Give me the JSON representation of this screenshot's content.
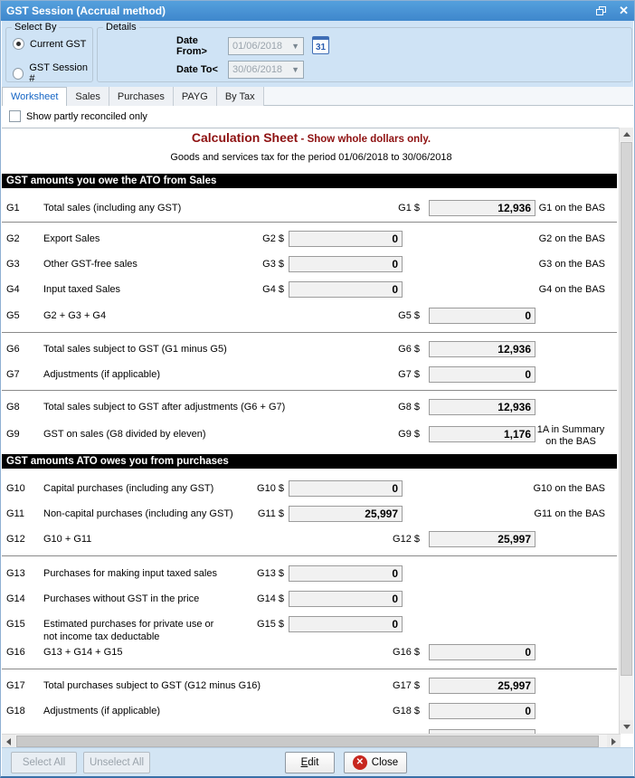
{
  "window": {
    "title": "GST Session (Accrual method)"
  },
  "select_by": {
    "legend": "Select By",
    "options": [
      {
        "label": "Current GST",
        "selected": true
      },
      {
        "label": "GST Session #",
        "selected": false
      }
    ]
  },
  "details": {
    "legend": "Details",
    "date_from_label": "Date From>",
    "date_from_value": "01/06/2018",
    "date_to_label": "Date To<",
    "date_to_value": "30/06/2018",
    "calendar_icon": "31"
  },
  "tabs": [
    {
      "label": "Worksheet",
      "active": true
    },
    {
      "label": "Sales",
      "active": false
    },
    {
      "label": "Purchases",
      "active": false
    },
    {
      "label": "PAYG",
      "active": false
    },
    {
      "label": "By Tax",
      "active": false
    }
  ],
  "filter": {
    "checkbox_label": "Show partly reconciled only",
    "checked": false
  },
  "sheet": {
    "title": "Calculation Sheet",
    "title_separator": " - ",
    "title_suffix": "Show whole dollars only.",
    "period_line": "Goods and services tax for the period 01/06/2018 to 30/06/2018",
    "accent_color": "#8e1111",
    "sections": [
      {
        "title": "GST amounts you owe the ATO from Sales"
      },
      {
        "title": "GST amounts ATO owes you from purchases"
      }
    ],
    "rows": [
      {
        "code": "G1",
        "desc": "Total sales (including any GST)",
        "label": "G1 $",
        "value": "12,936",
        "note": "G1 on the BAS"
      },
      {
        "code": "G2",
        "desc": "Export Sales",
        "label": "G2 $",
        "value": "0",
        "note": "G2 on the BAS"
      },
      {
        "code": "G3",
        "desc": "Other GST-free sales",
        "label": "G3 $",
        "value": "0",
        "note": "G3 on the BAS"
      },
      {
        "code": "G4",
        "desc": "Input taxed Sales",
        "label": "G4 $",
        "value": "0",
        "note": "G4 on the BAS"
      },
      {
        "code": "G5",
        "desc": "G2 + G3 + G4",
        "label": "G5 $",
        "value": "0",
        "note": ""
      },
      {
        "code": "G6",
        "desc": "Total sales subject to GST (G1 minus G5)",
        "label": "G6 $",
        "value": "12,936",
        "note": ""
      },
      {
        "code": "G7",
        "desc": "Adjustments (if applicable)",
        "label": "G7 $",
        "value": "0",
        "note": ""
      },
      {
        "code": "G8",
        "desc": "Total sales subject to GST after adjustments (G6 + G7)",
        "label": "G8 $",
        "value": "12,936",
        "note": ""
      },
      {
        "code": "G9",
        "desc": "GST on sales (G8 divided by eleven)",
        "label": "G9 $",
        "value": "1,176",
        "note": "1A in Summary\non the BAS"
      },
      {
        "code": "G10",
        "desc": "Capital purchases (including any GST)",
        "label": "G10 $",
        "value": "0",
        "note": "G10 on the BAS"
      },
      {
        "code": "G11",
        "desc": "Non-capital purchases (including any GST)",
        "label": "G11 $",
        "value": "25,997",
        "note": "G11 on the BAS"
      },
      {
        "code": "G12",
        "desc": "G10 + G11",
        "label": "G12 $",
        "value": "25,997",
        "note": ""
      },
      {
        "code": "G13",
        "desc": "Purchases for making input taxed sales",
        "label": "G13 $",
        "value": "0",
        "note": ""
      },
      {
        "code": "G14",
        "desc": "Purchases without GST in the price",
        "label": "G14 $",
        "value": "0",
        "note": ""
      },
      {
        "code": "G15",
        "desc": "Estimated purchases for private use or\nnot income tax deductable",
        "label": "G15 $",
        "value": "0",
        "note": ""
      },
      {
        "code": "G16",
        "desc": "G13 + G14 + G15",
        "label": "G16 $",
        "value": "0",
        "note": ""
      },
      {
        "code": "G17",
        "desc": "Total purchases subject to GST (G12 minus G16)",
        "label": "G17 $",
        "value": "25,997",
        "note": ""
      },
      {
        "code": "G18",
        "desc": "Adjustments (if applicable)",
        "label": "G18 $",
        "value": "0",
        "note": ""
      }
    ]
  },
  "footer": {
    "select_all": "Select All",
    "unselect_all": "Unselect All",
    "edit": "Edit",
    "close": "Close"
  }
}
